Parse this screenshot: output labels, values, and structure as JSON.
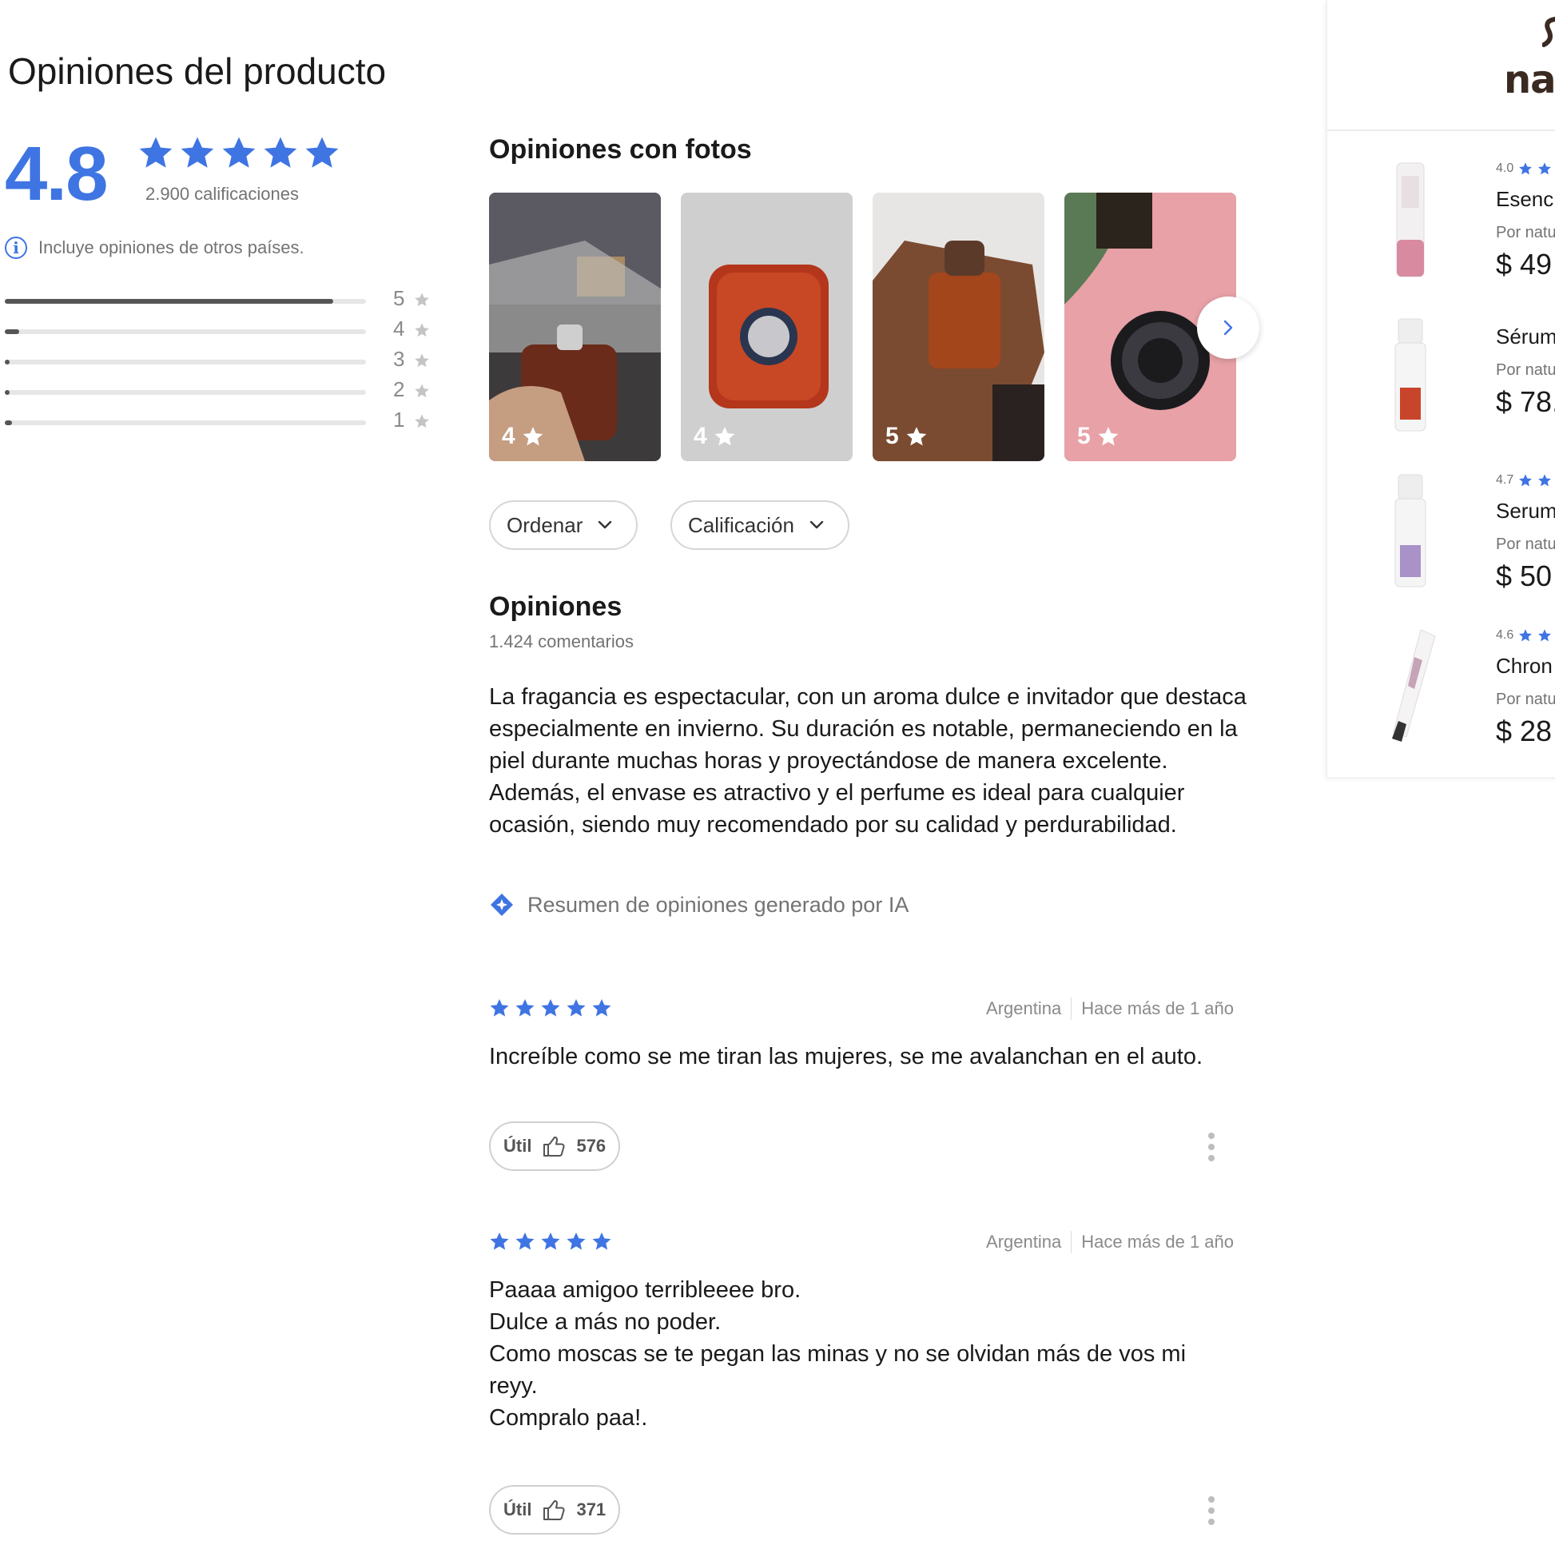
{
  "page": {
    "title": "Opiniones del producto"
  },
  "rating": {
    "average": "4.8",
    "count_label": "2.900 calificaciones",
    "info_text": "Incluye opiniones de otros países.",
    "distribution": [
      {
        "stars": "5",
        "fraction": 0.91
      },
      {
        "stars": "4",
        "fraction": 0.04
      },
      {
        "stars": "3",
        "fraction": 0.01
      },
      {
        "stars": "2",
        "fraction": 0.005
      },
      {
        "stars": "1",
        "fraction": 0.02
      }
    ]
  },
  "photos": {
    "title": "Opiniones con fotos",
    "items": [
      {
        "rating": "4"
      },
      {
        "rating": "4"
      },
      {
        "rating": "5"
      },
      {
        "rating": "5"
      }
    ]
  },
  "filters": {
    "sort_label": "Ordenar",
    "rating_label": "Calificación"
  },
  "reviews": {
    "title": "Opiniones",
    "count_label": "1.424 comentarios",
    "summary": "La fragancia es espectacular, con un aroma dulce e invitador que destaca especialmente en invierno. Su duración es notable, permaneciendo en la piel durante muchas horas y proyectándose de manera excelente. Además, el envase es atractivo y el perfume es ideal para cualquier ocasión, siendo muy recomendado por su calidad y perdurabilidad.",
    "ai_label": "Resumen de opiniones generado por IA",
    "helpful_label": "Útil",
    "items": [
      {
        "stars": 5,
        "country": "Argentina",
        "date": "Hace más de 1 año",
        "text": "Increíble como se me tiran las mujeres, se me avalanchan en el auto.",
        "helpful": "576"
      },
      {
        "stars": 5,
        "country": "Argentina",
        "date": "Hace más de 1 año",
        "text": "Paaaa amigoo terribleeee bro.\nDulce a más no poder.\nComo moscas se te pegan las minas y no se olvidan más de vos mi reyy.\nCompralo paa!.",
        "helpful": "371"
      }
    ]
  },
  "sidebar": {
    "brand": "na",
    "products": [
      {
        "rating": "4.0",
        "name": "Esenc",
        "seller": "Por natu",
        "price": "$ 49"
      },
      {
        "rating": "",
        "name": "Sérum",
        "seller": "Por natu",
        "price": "$ 78."
      },
      {
        "rating": "4.7",
        "name": "Serum",
        "seller": "Por natu",
        "price": "$ 50"
      },
      {
        "rating": "4.6",
        "name": "Chron",
        "seller": "Por natu",
        "price": "$ 28"
      }
    ]
  },
  "colors": {
    "accent": "#3f74e3",
    "bar": "#555555",
    "track": "#e6e6e6"
  }
}
